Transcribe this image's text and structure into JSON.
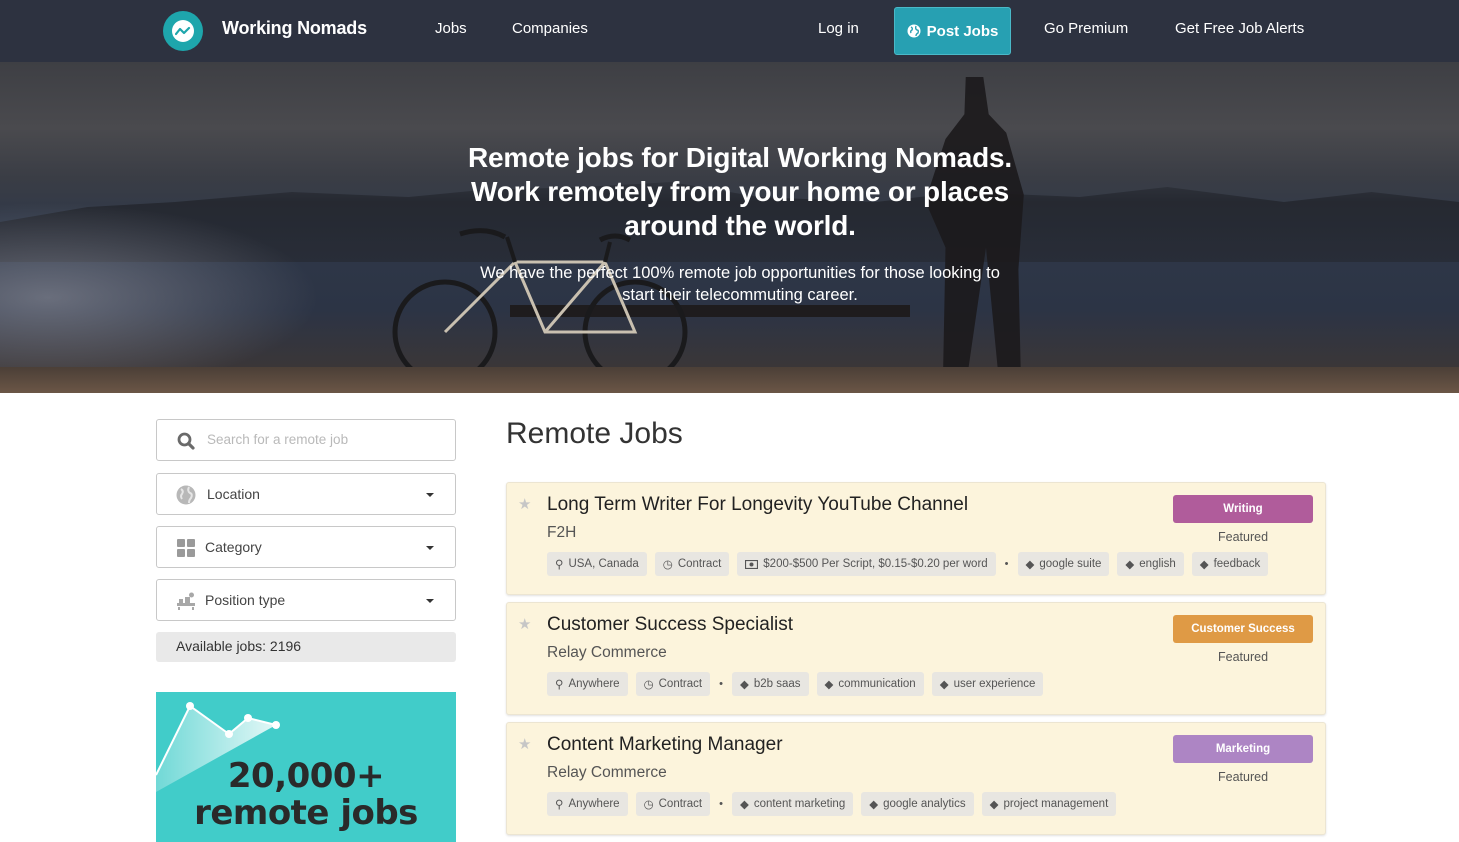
{
  "navbar": {
    "brand": "Working Nomads",
    "links": {
      "jobs": "Jobs",
      "companies": "Companies",
      "login": "Log in",
      "post_jobs": "Post Jobs",
      "premium": "Go Premium",
      "alerts": "Get Free Job Alerts"
    },
    "colors": {
      "background": "#2d3240",
      "post_button": "#27a0b2",
      "logo": "#1ea6ac"
    }
  },
  "hero": {
    "title_line1": "Remote jobs for Digital Working Nomads.",
    "title_line2": "Work remotely from your home or places",
    "title_line3": "around the world.",
    "subtitle_line1": "We have the perfect 100% remote job opportunities for those looking to",
    "subtitle_line2": "start their telecommuting career."
  },
  "sidebar": {
    "search": {
      "placeholder": "Search for a remote job",
      "value": "",
      "icon": "search-icon"
    },
    "filters": [
      {
        "label": "Location",
        "icon": "globe-icon"
      },
      {
        "label": "Category",
        "icon": "grid-icon"
      },
      {
        "label": "Position type",
        "icon": "desk-icon"
      }
    ],
    "available_jobs": "Available jobs: 2196",
    "promo": {
      "line1": "20,000+",
      "line2": "remote jobs",
      "color": "#41ccc9"
    }
  },
  "main": {
    "title": "Remote Jobs",
    "jobs": [
      {
        "title": "Long Term Writer For Longevity YouTube Channel",
        "company": "F2H",
        "category": "Writing",
        "category_color": "#b05c9b",
        "featured": "Featured",
        "location": "USA, Canada",
        "type": "Contract",
        "salary": "$200-$500 Per Script, $0.15-$0.20 per word",
        "tags": [
          "google suite",
          "english",
          "feedback"
        ]
      },
      {
        "title": "Customer Success Specialist",
        "company": "Relay Commerce",
        "category": "Customer Success",
        "category_color": "#df9a45",
        "featured": "Featured",
        "location": "Anywhere",
        "type": "Contract",
        "tags": [
          "b2b saas",
          "communication",
          "user experience"
        ]
      },
      {
        "title": "Content Marketing Manager",
        "company": "Relay Commerce",
        "category": "Marketing",
        "category_color": "#ad85c4",
        "featured": "Featured",
        "location": "Anywhere",
        "type": "Contract",
        "tags": [
          "content marketing",
          "google analytics",
          "project management"
        ]
      }
    ],
    "separator": "•"
  }
}
